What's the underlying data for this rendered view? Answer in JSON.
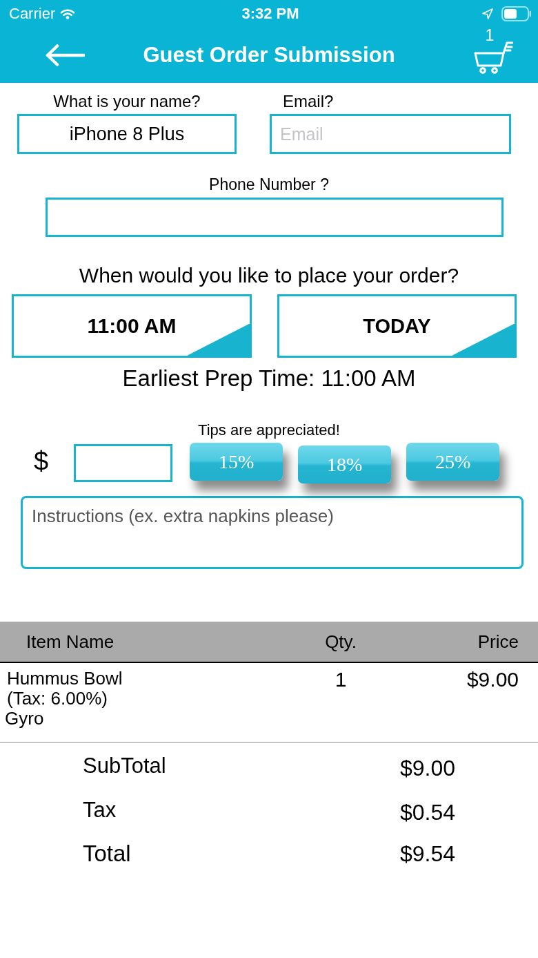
{
  "status_bar": {
    "carrier": "Carrier",
    "time": "3:32 PM"
  },
  "nav": {
    "title": "Guest Order Submission",
    "cart_count": "1"
  },
  "form": {
    "name": {
      "label": "What is your name?",
      "value": "iPhone 8 Plus"
    },
    "email": {
      "label": "Email?",
      "placeholder": "Email"
    },
    "phone": {
      "label": "Phone Number ?"
    }
  },
  "schedule": {
    "question": "When would you like to place your order?",
    "time": "11:00 AM",
    "day": "TODAY",
    "earliest_prep": "Earliest Prep Time: 11:00 AM"
  },
  "tips": {
    "heading": "Tips are appreciated!",
    "currency": "$",
    "options": [
      "15%",
      "18%",
      "25%"
    ]
  },
  "instructions": {
    "placeholder": "Instructions (ex. extra napkins please)"
  },
  "table": {
    "columns": [
      "Item Name",
      "Qty.",
      "Price"
    ],
    "rows": [
      {
        "name": "Hummus Bowl",
        "tax": "(Tax: 6.00%)",
        "modifier": "Gyro",
        "qty": "1",
        "price": "$9.00"
      }
    ]
  },
  "totals": [
    {
      "kind": "line",
      "label": "SubTotal",
      "value": "$9.00"
    },
    {
      "kind": "line",
      "label": "Tax",
      "value": "$0.54"
    },
    {
      "kind": "grand",
      "label": "Total",
      "value": "$9.54"
    }
  ]
}
